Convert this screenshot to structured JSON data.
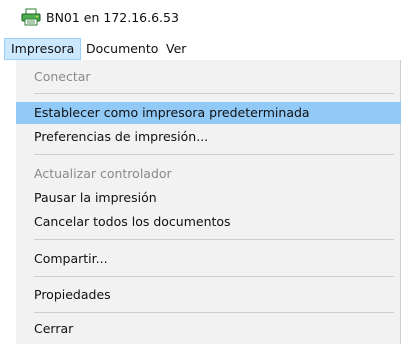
{
  "window": {
    "title": "BN01 en 172.16.6.53",
    "icon": "printer-icon"
  },
  "menubar": {
    "items": [
      {
        "label": "Impresora",
        "active": true
      },
      {
        "label": "Documento",
        "active": false
      },
      {
        "label": "Ver",
        "active": false
      }
    ]
  },
  "printer_menu": {
    "items": [
      {
        "label": "Conectar",
        "enabled": false
      },
      {
        "label": "Establecer como impresora predeterminada",
        "enabled": true,
        "highlighted": true
      },
      {
        "label": "Preferencias de impresión...",
        "enabled": true
      },
      {
        "label": "Actualizar controlador",
        "enabled": false
      },
      {
        "label": "Pausar la impresión",
        "enabled": true
      },
      {
        "label": "Cancelar todos los documentos",
        "enabled": true
      },
      {
        "label": "Compartir...",
        "enabled": true
      },
      {
        "label": "Propiedades",
        "enabled": true
      },
      {
        "label": "Cerrar",
        "enabled": true
      }
    ]
  },
  "colors": {
    "highlight": "#91c9f7",
    "menu_background": "#f2f2f2",
    "disabled_text": "#8a8a8a"
  }
}
